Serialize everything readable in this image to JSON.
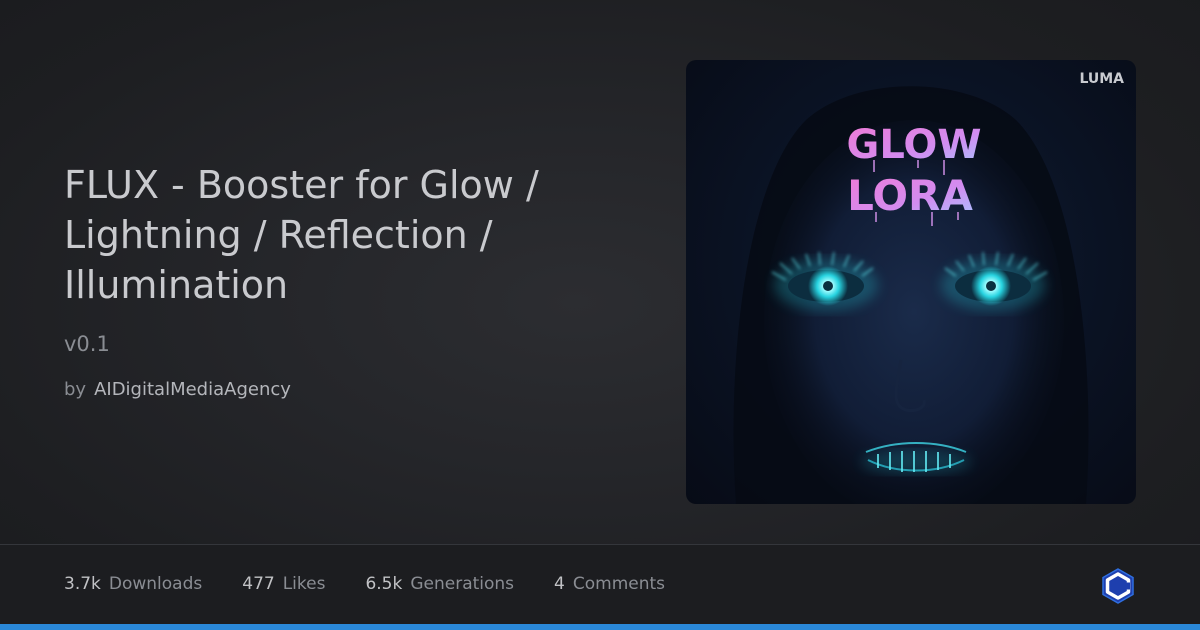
{
  "model": {
    "title": "FLUX - Booster for Glow / Lightning / Reflection / Illumination",
    "version": "v0.1",
    "by_label": "by",
    "author": "AIDigitalMediaAgency"
  },
  "preview": {
    "watermark": "LUMA",
    "art_text_line1": "GLOW",
    "art_text_line2": "LORA"
  },
  "stats": [
    {
      "value": "3.7k",
      "label": "Downloads"
    },
    {
      "value": "477",
      "label": "Likes"
    },
    {
      "value": "6.5k",
      "label": "Generations"
    },
    {
      "value": "4",
      "label": "Comments"
    }
  ],
  "brand": {
    "logo_icon": "civitai-logo-icon",
    "accent_color": "#2a88d8"
  }
}
